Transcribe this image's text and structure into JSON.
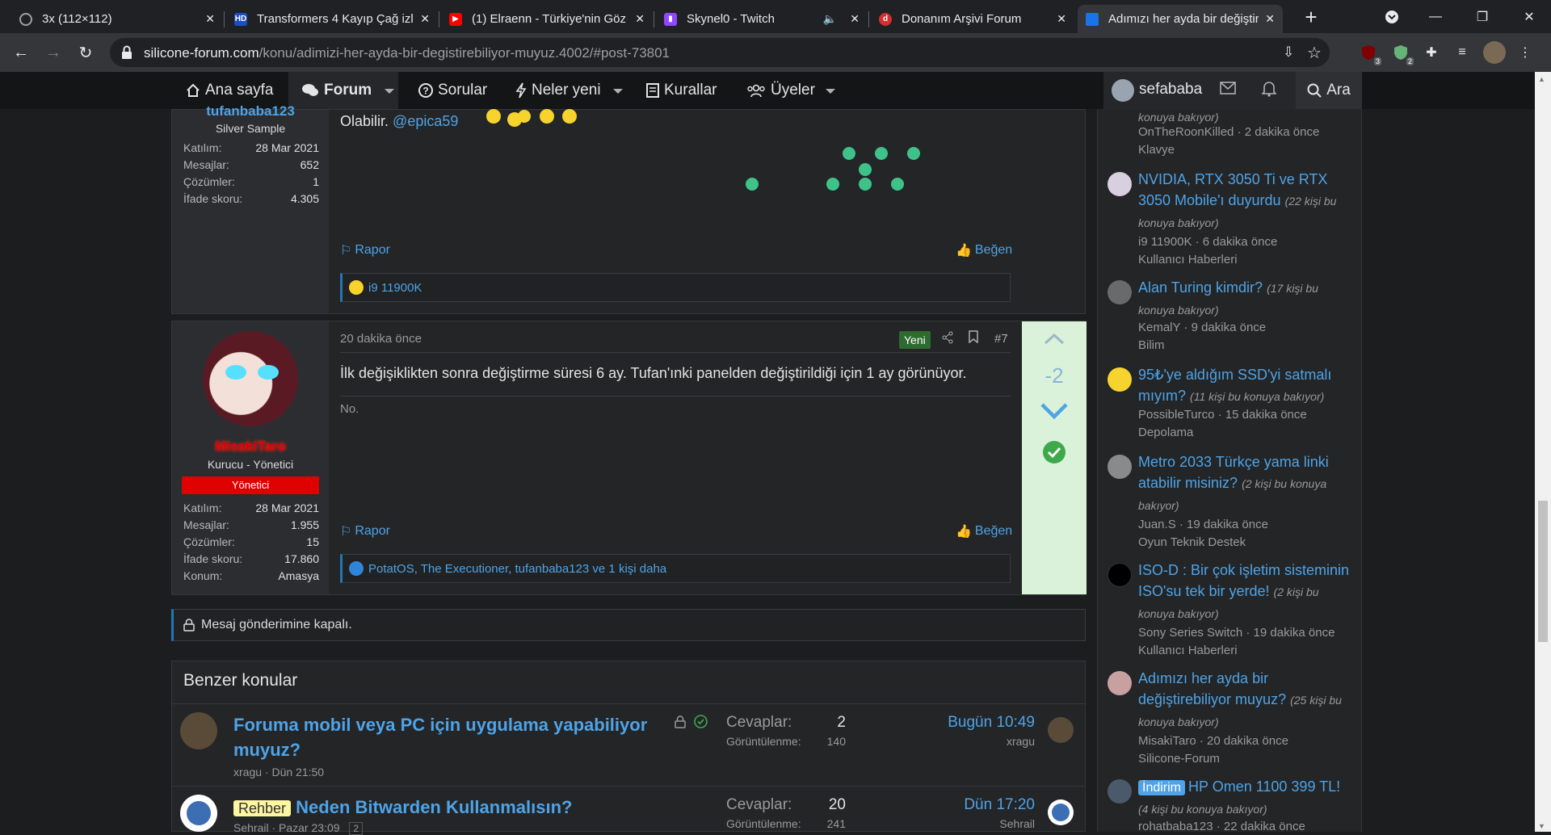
{
  "browser": {
    "tabs": [
      {
        "title": "3x (112×112)",
        "icon": "globe-icon"
      },
      {
        "title": "Transformers 4 Kayıp Çağ izle",
        "icon": "hd-icon"
      },
      {
        "title": "(1) Elraenn - Türkiye'nin Göz",
        "icon": "youtube-icon"
      },
      {
        "title": "Skynel0 - Twitch",
        "icon": "twitch-icon"
      },
      {
        "title": "Donanım Arşivi Forum",
        "icon": "da-icon"
      },
      {
        "title": "Adımızı her ayda bir değiştir",
        "icon": "site-icon",
        "active": true
      }
    ],
    "url_domain": "silicone-forum.com",
    "url_path": "/konu/adimizi-her-ayda-bir-degistirebiliyor-muyuz.4002/#post-73801",
    "ext_badges": {
      "ublock": "3",
      "adguard": "2"
    }
  },
  "nav": {
    "home": "Ana sayfa",
    "forum": "Forum",
    "questions": "Sorular",
    "whats_new": "Neler yeni",
    "rules": "Kurallar",
    "members": "Üyeler",
    "username": "sefababa",
    "search": "Ara"
  },
  "post6": {
    "username": "tufanbaba123",
    "user_title": "Silver Sample",
    "stats": [
      {
        "label": "Katılım:",
        "value": "28 Mar 2021"
      },
      {
        "label": "Mesajlar:",
        "value": "652"
      },
      {
        "label": "Çözümler:",
        "value": "1"
      },
      {
        "label": "İfade skoru:",
        "value": "4.305"
      }
    ],
    "text": "Olabilir.",
    "mention": "@epica59",
    "report": "Rapor",
    "like": "Beğen",
    "reactions": "i9 11900K"
  },
  "post7": {
    "time": "20 dakika önce",
    "new_badge": "Yeni",
    "number": "#7",
    "username": "MisakiTaro",
    "user_title": "Kurucu - Yönetici",
    "banner": "Yönetici",
    "stats": [
      {
        "label": "Katılım:",
        "value": "28 Mar 2021"
      },
      {
        "label": "Mesajlar:",
        "value": "1.955"
      },
      {
        "label": "Çözümler:",
        "value": "15"
      },
      {
        "label": "İfade skoru:",
        "value": "17.860"
      },
      {
        "label": "Konum:",
        "value": "Amasya"
      }
    ],
    "text": "İlk değişiklikten sonra değiştirme süresi 6 ay. Tufan'ınki panelden değiştirildiği için 1 ay görünüyor.",
    "signature": "No.",
    "report": "Rapor",
    "like": "Beğen",
    "reactions": "PotatOS, The Executioner, tufanbaba123 ve 1 kişi daha",
    "vote_score": "-2"
  },
  "notice": "Mesaj gönderimine kapalı.",
  "similar": {
    "heading": "Benzer konular",
    "rows": [
      {
        "title": "Foruma mobil veya PC için uygulama yapabiliyor muyuz?",
        "meta": "xragu · Dün 21:50",
        "replies_label": "Cevaplar:",
        "replies": "2",
        "views_label": "Görüntülenme:",
        "views": "140",
        "last_date": "Bugün 10:49",
        "last_user": "xragu"
      },
      {
        "prefix": "Rehber",
        "title": "Neden Bitwarden Kullanmalısın?",
        "meta": "Sehrail · Pazar 23:09",
        "pages": "2",
        "replies_label": "Cevaplar:",
        "replies": "20",
        "views_label": "Görüntülenme:",
        "views": "241",
        "last_date": "Dün 17:20",
        "last_user": "Sehrail"
      }
    ]
  },
  "sidebar": {
    "items": [
      {
        "title_tail": "konuya bakıyor)",
        "meta": "OnTheRoonKilled · 2 dakika önce",
        "forum": "Klavye"
      },
      {
        "title": "NVIDIA, RTX 3050 Ti ve RTX 3050 Mobile'ı duyurdu",
        "viewers": "(22 kişi bu konuya bakıyor)",
        "meta": "i9 11900K · 6 dakika önce",
        "forum": "Kullanıcı Haberleri"
      },
      {
        "title": "Alan Turing kimdir?",
        "viewers": "(17 kişi bu konuya bakıyor)",
        "meta": "KemalY · 9 dakika önce",
        "forum": "Bilim"
      },
      {
        "title": "95₺'ye aldığım SSD'yi satmalı mıyım?",
        "viewers": "(11 kişi bu konuya bakıyor)",
        "meta": "PossibleTurco · 15 dakika önce",
        "forum": "Depolama"
      },
      {
        "title": "Metro 2033 Türkçe yama linki atabilir misiniz?",
        "viewers": "(2 kişi bu konuya bakıyor)",
        "meta": "Juan.S · 19 dakika önce",
        "forum": "Oyun Teknik Destek"
      },
      {
        "title": "ISO-D : Bir çok işletim sisteminin ISO'su tek bir yerde!",
        "viewers": "(2 kişi bu konuya bakıyor)",
        "meta": "Sony Series Switch · 19 dakika önce",
        "forum": "Kullanıcı Haberleri"
      },
      {
        "title": "Adımızı her ayda bir değiştirebiliyor muyuz?",
        "viewers": "(25 kişi bu konuya bakıyor)",
        "meta": "MisakiTaro · 20 dakika önce",
        "forum": "Silicone-Forum"
      },
      {
        "prefix": "İndirim",
        "title": "HP Omen 1100 399 TL!",
        "viewers": "(4 kişi bu konuya bakıyor)",
        "meta": "rohatbaba123 · 22 dakika önce"
      }
    ]
  },
  "colors": {
    "link": "#4fa3e6",
    "admin_red": "#e00000",
    "solution_green": "#3ea94b",
    "vote_panel": "#d9f2d9"
  }
}
